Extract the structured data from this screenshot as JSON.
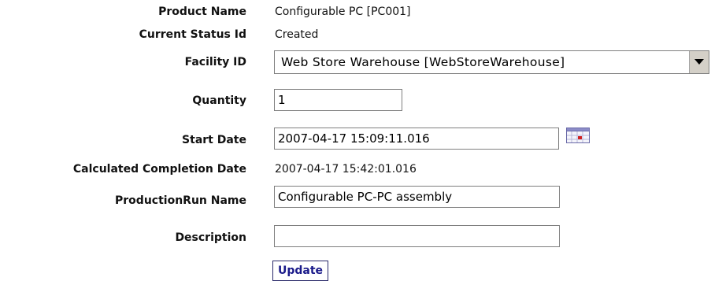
{
  "form": {
    "product_name": {
      "label": "Product Name",
      "value": "Configurable PC [PC001]"
    },
    "current_status": {
      "label": "Current Status Id",
      "value": "Created"
    },
    "facility": {
      "label": "Facility ID",
      "selected": "Web Store Warehouse [WebStoreWarehouse]"
    },
    "quantity": {
      "label": "Quantity",
      "value": "1"
    },
    "start_date": {
      "label": "Start Date",
      "value": "2007-04-17 15:09:11.016",
      "icon": "calendar-icon"
    },
    "completion_date": {
      "label": "Calculated Completion Date",
      "value": "2007-04-17 15:42:01.016"
    },
    "production_run_name": {
      "label": "ProductionRun Name",
      "value": "Configurable PC-PC assembly"
    },
    "description": {
      "label": "Description",
      "value": ""
    },
    "update_button": {
      "label": "Update"
    }
  },
  "colors": {
    "button_text": "#1a1a8a",
    "input_border": "#7f7f7f",
    "select_button_bg": "#d4d0c8"
  }
}
